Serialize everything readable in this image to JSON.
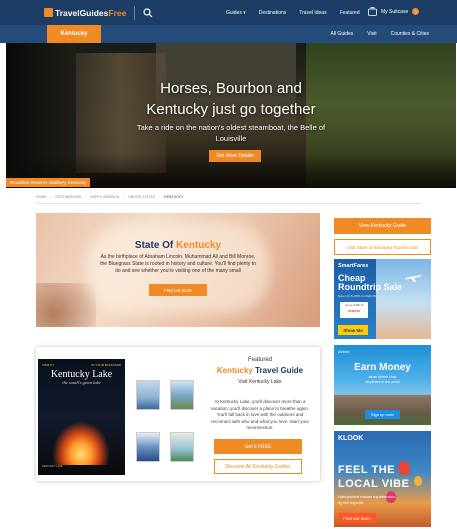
{
  "topnav": {
    "logo_main": "TravelGuides",
    "logo_accent": "Free",
    "links": [
      "Guides ▾",
      "Destinations",
      "Travel Ideas",
      "Featured"
    ],
    "suitcase_label": "My Suitcase",
    "suitcase_count": "0"
  },
  "subnav": {
    "state_tab": "Kentucky",
    "links": [
      "All Guides",
      "Visit",
      "Counties & Cities"
    ]
  },
  "hero": {
    "title_line1": "Horses, Bourbon and",
    "title_line2": "Kentucky just go together",
    "sub_line1": "Take a ride on the nation's oldest steamboat, the Belle of",
    "sub_line2": "Louisville",
    "button": "Get More Details",
    "caption": "Woodford Reserve Distillery, Kentucky"
  },
  "breadcrumb": [
    "HOME",
    "DESTINATIONS",
    "NORTH AMERICA",
    "UNITED STATES",
    "KENTUCKY"
  ],
  "state_card": {
    "title_prefix": "State Of",
    "title_accent": "Kentucky",
    "text_line1": "As the birthplace of Abraham Lincoln, Muhammad Ali and Bill Monroe,",
    "text_line2": "the Bluegrass State is rooted in history and culture. You'll find plenty to",
    "text_line3": "do and see whether you're visiting one of the many small",
    "button": "Find out more"
  },
  "guide_card": {
    "cover_tag_left": "VISIT KY",
    "cover_tag_right": "IN YOUR BACKYARD",
    "cover_title": "Kentucky Lake",
    "cover_subtitle": "the south's great lake",
    "cover_footer": "KENTUCKY LAKE",
    "pre_title": "Featured",
    "title_accent": "Kentucky",
    "title_rest": "Travel Guide",
    "visit": "Visit Kentucky Lake",
    "text_line1": "At Kentucky Lake, you'll discover more than a",
    "text_line2": "vacation; you'll discover a place to breathe again.",
    "text_line3": "You'll fall back in love with the outdoors and",
    "text_line4": "reconnect with who and what you love. Start your",
    "text_line5": "reconnection.",
    "button_primary": "Get it FREE",
    "button_secondary": "Discover All Kentucky Guides"
  },
  "sidebar": {
    "button_primary": "View Kentucky Guide",
    "button_secondary": "Visit State of Kentucky Tourism Site"
  },
  "ads": {
    "smartfares": {
      "brand": "SmartFares",
      "headline1": "Cheap",
      "headline2": "Roundtrip Sale",
      "small": "Save Up To 65% on Flight Bookings",
      "promo_label": "Get up to $50 off",
      "promo_code": "SFWT15",
      "button": "Show Me"
    },
    "airbnb": {
      "brand": "Airbnb",
      "headline": "Earn Money",
      "text1": "as an Airbnb Host",
      "text2": "anywhere in the world",
      "button": "Sign up now!"
    },
    "klook": {
      "brand": "KLOOK",
      "headline1": "FEEL THE",
      "headline2": "LOCAL VIBE",
      "text1": "Handpicked insider experiences",
      "text2": "by the experts",
      "button": "Find out more"
    }
  },
  "colors": {
    "nav": "#1c3d66",
    "subnav": "#244b7a",
    "accent": "#f08a24"
  },
  "icons": [
    "logo-mark-icon",
    "search-icon",
    "suitcase-icon",
    "plane-icon"
  ]
}
